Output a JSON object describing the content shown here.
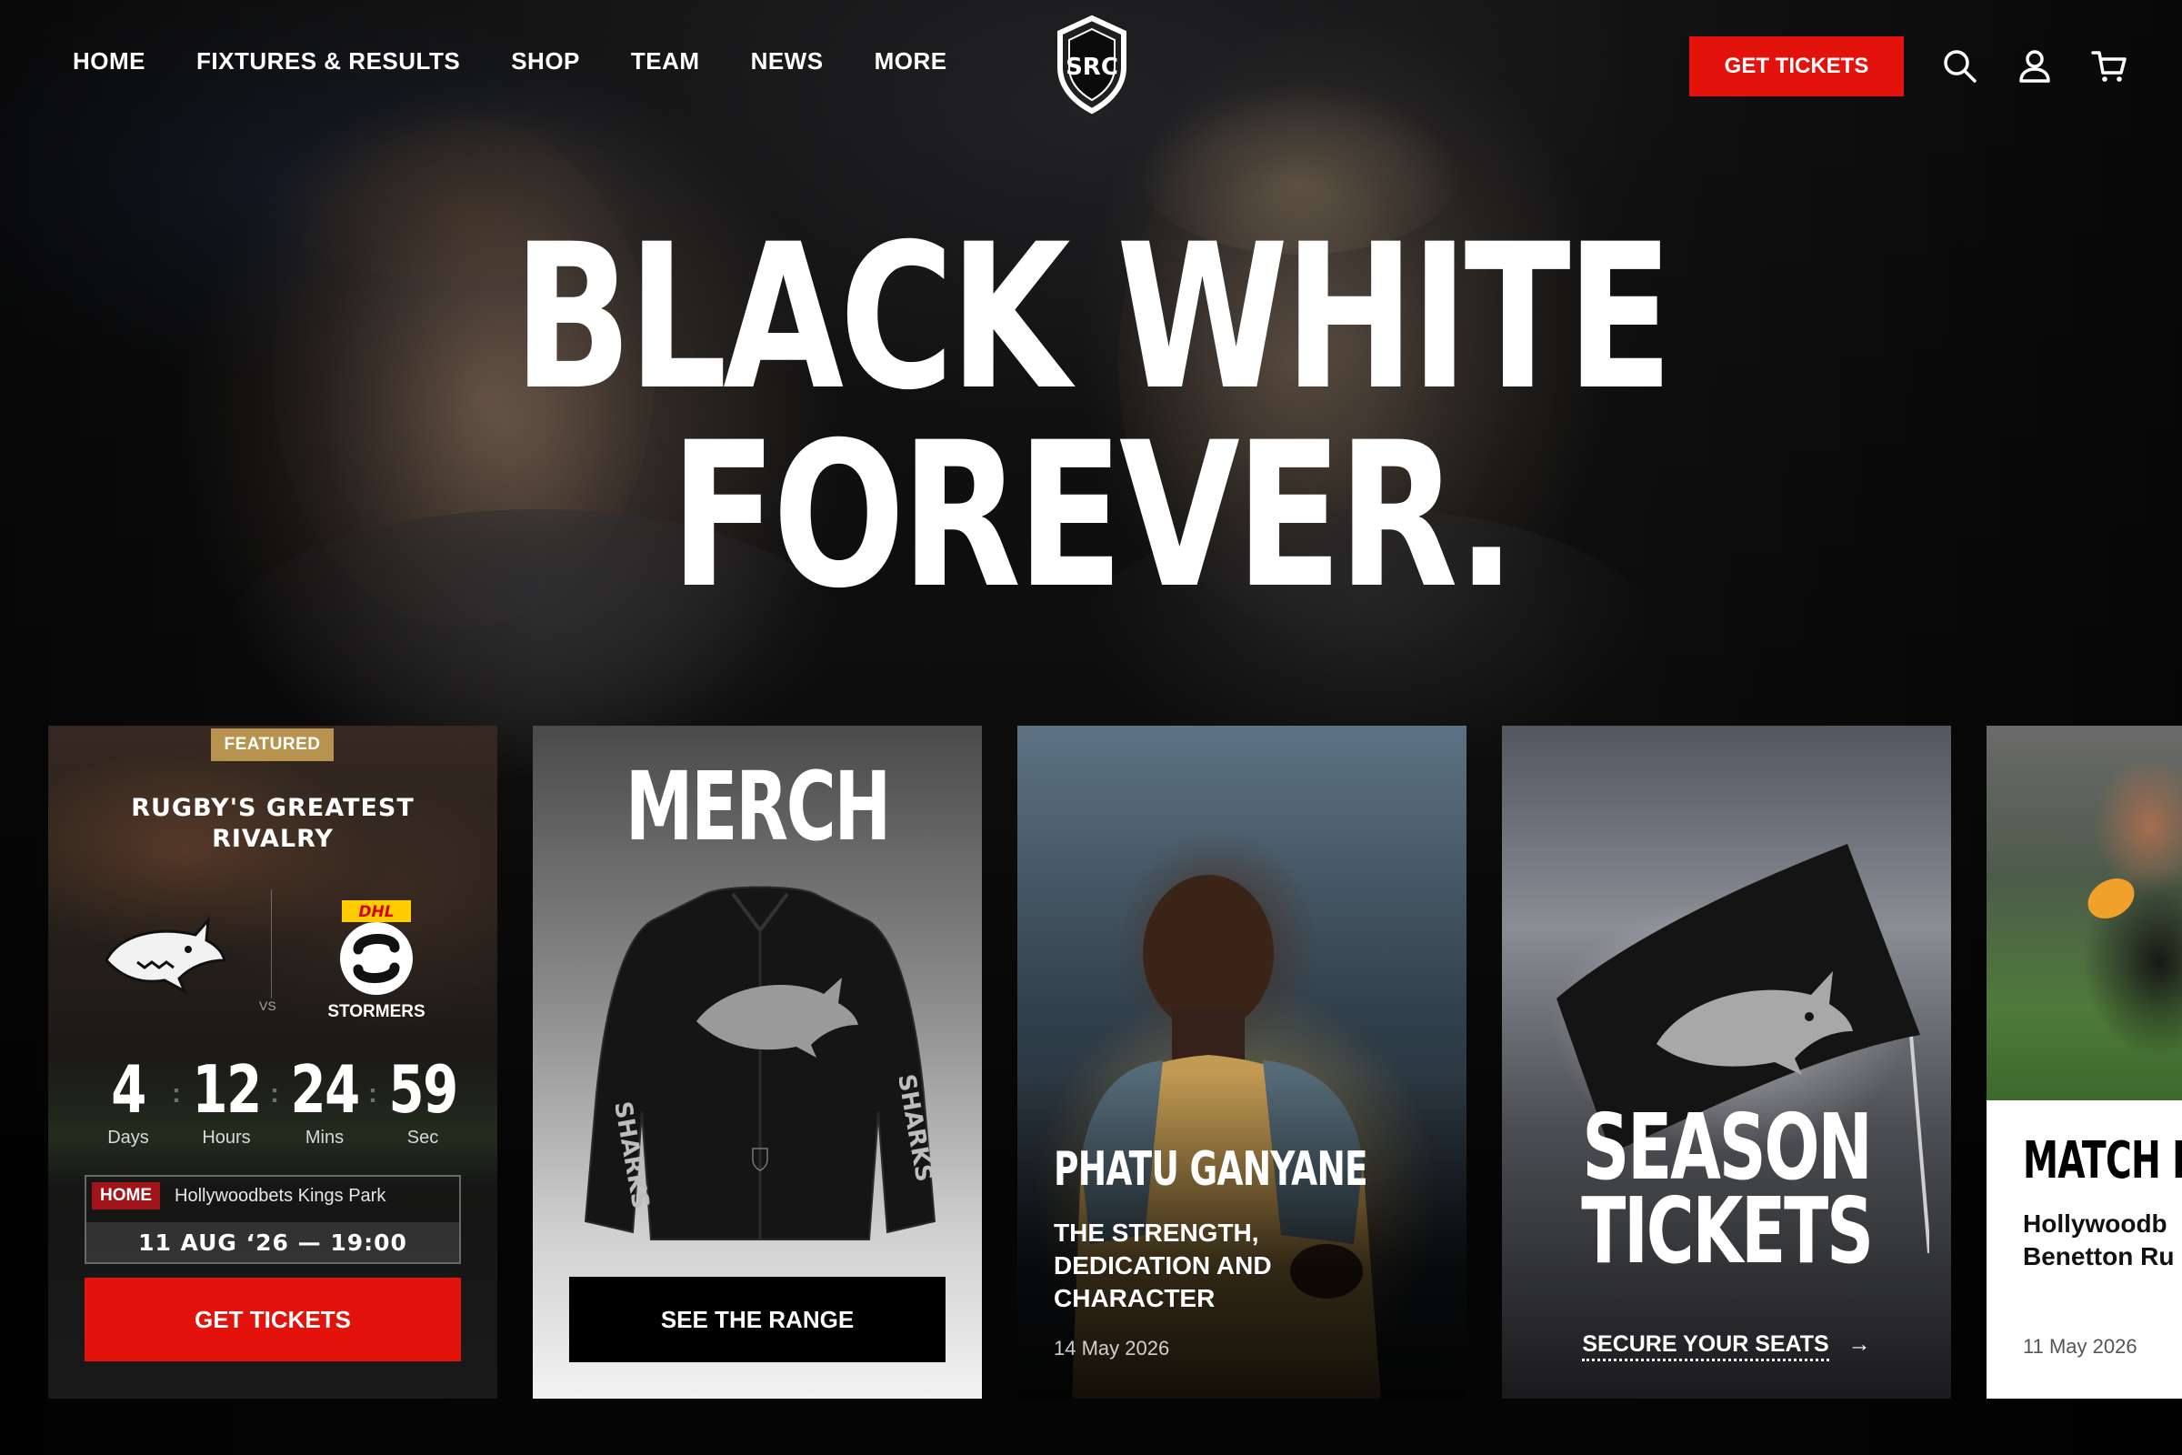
{
  "nav": {
    "links": [
      "HOME",
      "FIXTURES & RESULTS",
      "SHOP",
      "TEAM",
      "NEWS",
      "MORE"
    ],
    "logo_text": "SRC",
    "tickets_label": "GET TICKETS",
    "icons": [
      "search-icon",
      "account-icon",
      "cart-icon"
    ]
  },
  "hero": {
    "line1": "BLACK WHITE",
    "line2": "FOREVER."
  },
  "cards": {
    "fixture": {
      "badge": "FEATURED",
      "title_line1": "RUGBY'S GREATEST",
      "title_line2": "RIVALRY",
      "vs": "VS",
      "away_team": "STORMERS",
      "away_sponsor": "DHL",
      "countdown": [
        {
          "value": "4",
          "label": "Days"
        },
        {
          "value": "12",
          "label": "Hours"
        },
        {
          "value": "24",
          "label": "Mins"
        },
        {
          "value": "59",
          "label": "Sec"
        }
      ],
      "home_tag": "HOME",
      "venue": "Hollywoodbets Kings Park",
      "datetime": "11 AUG ‘26  —  19:00",
      "button": "GET TICKETS"
    },
    "merch": {
      "title": "MERCH",
      "jacket_text": "SHARKS",
      "button": "SEE THE RANGE"
    },
    "player": {
      "name": "PHATU GANYANE",
      "desc_line1": "THE STRENGTH,",
      "desc_line2": "DEDICATION AND",
      "desc_line3": "CHARACTER",
      "date": "14 May 2026"
    },
    "season": {
      "line1": "SEASON",
      "line2": "TICKETS",
      "link": "SECURE YOUR SEATS"
    },
    "match": {
      "title": "MATCH REI",
      "desc_line1": "Hollywoodb",
      "desc_line2": "Benetton Ru",
      "date": "11 May 2026"
    }
  },
  "colors": {
    "accent_red": "#e3120b",
    "featured_gold": "#b8934f",
    "home_tag_red": "#a0141a"
  }
}
